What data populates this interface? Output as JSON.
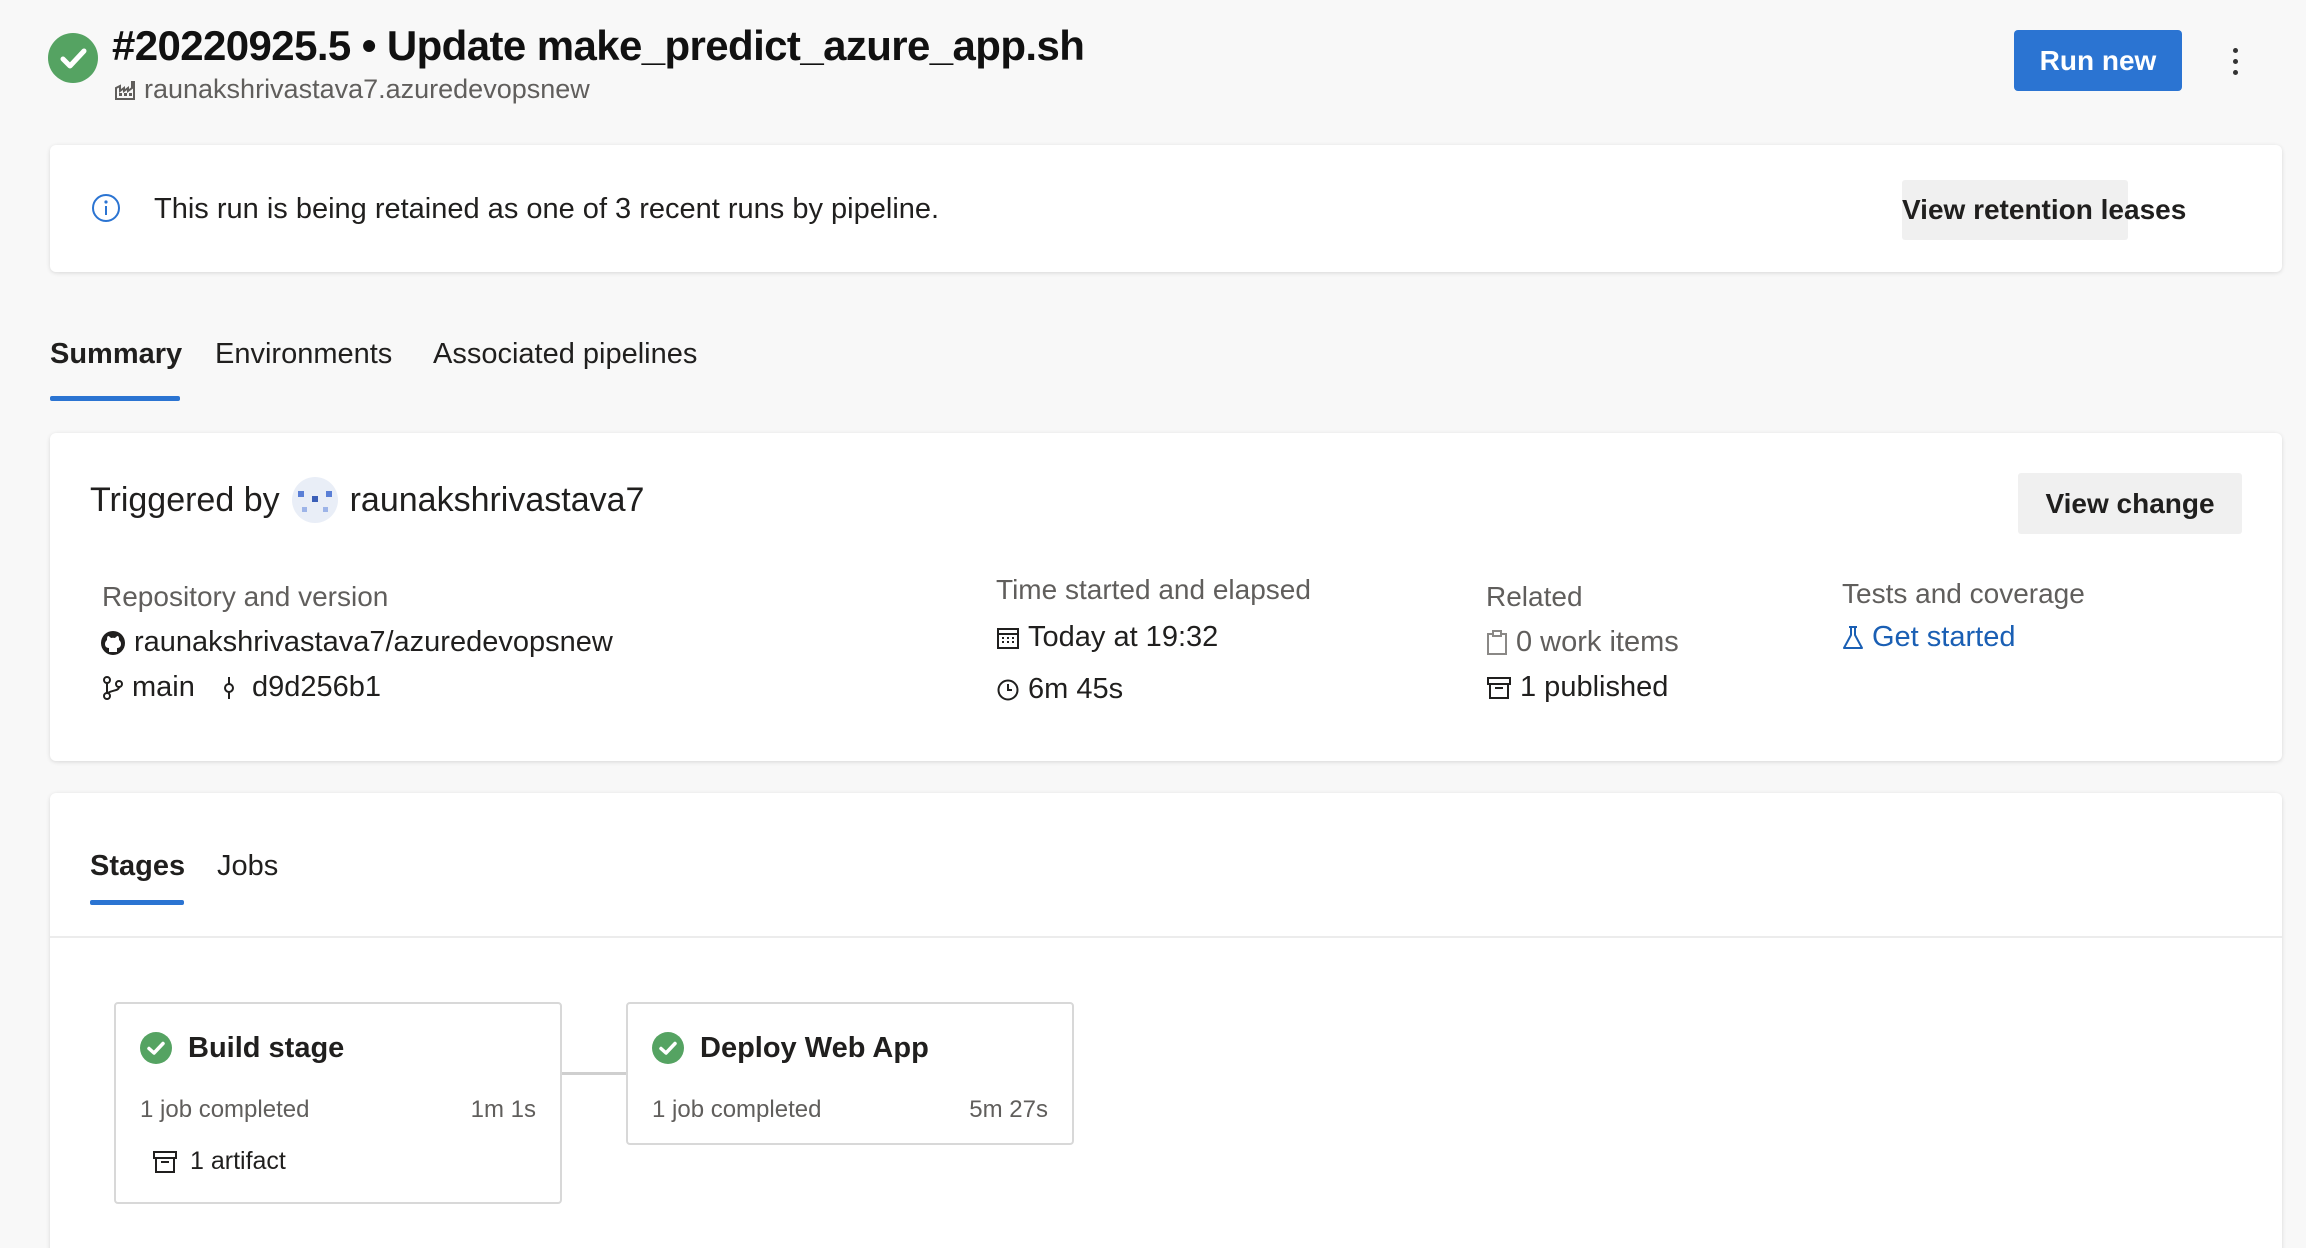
{
  "header": {
    "title": "#20220925.5 • Update make_predict_azure_app.sh",
    "subtitle": "raunakshrivastava7.azuredevopsnew",
    "run_new_label": "Run new",
    "status": "succeeded",
    "status_icon": "check-circle-icon"
  },
  "retention": {
    "message": "This run is being retained as one of 3 recent runs by pipeline.",
    "button_label": "View retention leases"
  },
  "tabs": [
    {
      "label": "Summary",
      "active": true
    },
    {
      "label": "Environments",
      "active": false
    },
    {
      "label": "Associated pipelines",
      "active": false
    }
  ],
  "summary": {
    "triggered_by_label": "Triggered by",
    "triggered_by_user": "raunakshrivastava7",
    "view_change_label": "View change",
    "repo": {
      "label": "Repository and version",
      "name": "raunakshrivastava7/azuredevopsnew",
      "branch": "main",
      "commit": "d9d256b1"
    },
    "time": {
      "label": "Time started and elapsed",
      "started": "Today at 19:32",
      "elapsed": "6m 45s"
    },
    "related": {
      "label": "Related",
      "work_items": "0 work items",
      "published": "1 published"
    },
    "tests": {
      "label": "Tests and coverage",
      "link": "Get started"
    }
  },
  "stages_tabs": [
    {
      "label": "Stages",
      "active": true
    },
    {
      "label": "Jobs",
      "active": false
    }
  ],
  "stages": [
    {
      "name": "Build stage",
      "jobs": "1 job completed",
      "duration": "1m 1s",
      "artifact": "1 artifact",
      "status": "succeeded"
    },
    {
      "name": "Deploy Web App",
      "jobs": "1 job completed",
      "duration": "5m 27s",
      "status": "succeeded"
    }
  ],
  "colors": {
    "accent": "#2b74d2",
    "success": "#55a362",
    "link": "#1a5fb4"
  }
}
